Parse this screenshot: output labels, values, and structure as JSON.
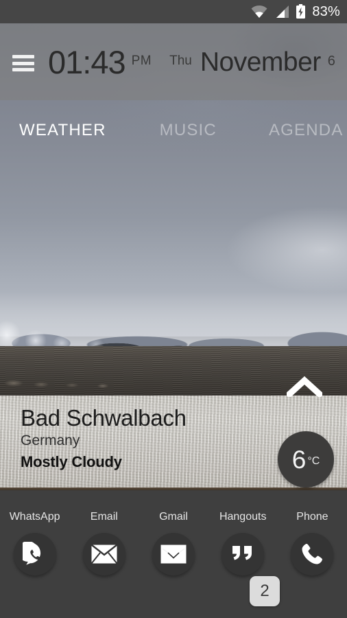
{
  "statusbar": {
    "battery_percent": "83%",
    "icons": [
      "wifi-icon",
      "cellular-signal-icon",
      "battery-charging-icon"
    ]
  },
  "header": {
    "menu_icon": "hamburger-menu-icon",
    "time": "01:43",
    "am_pm": "PM",
    "weekday": "Thu",
    "month": "November",
    "day": "6"
  },
  "tabs": [
    {
      "label": "WEATHER",
      "active": true
    },
    {
      "label": "MUSIC",
      "active": false
    },
    {
      "label": "AGENDA",
      "active": false
    }
  ],
  "expand": {
    "icon": "chevron-up-icon"
  },
  "weather": {
    "city": "Bad Schwalbach",
    "country": "Germany",
    "condition": "Mostly Cloudy",
    "temperature": "6",
    "unit": "°C",
    "badge_color": "#3d3c3b"
  },
  "dock": {
    "apps": [
      {
        "label": "WhatsApp",
        "icon": "whatsapp-icon"
      },
      {
        "label": "Email",
        "icon": "envelope-icon"
      },
      {
        "label": "Gmail",
        "icon": "gmail-icon"
      },
      {
        "label": "Hangouts",
        "icon": "quote-bubble-icon"
      },
      {
        "label": "Phone",
        "icon": "phone-handset-icon"
      }
    ],
    "background_color": "#3f3f3f"
  },
  "page_indicator": {
    "value": "2"
  }
}
